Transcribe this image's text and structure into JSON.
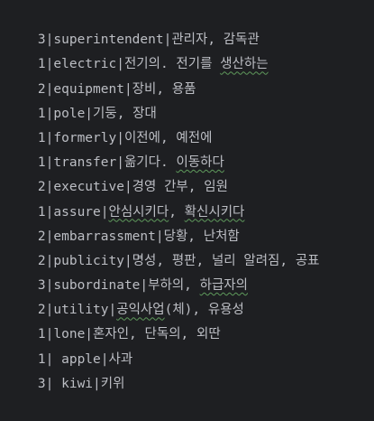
{
  "theme": {
    "background": "#1e1f22",
    "text_color": "#bcbec4",
    "squiggle_color": "#5f9a5c"
  },
  "lines": [
    {
      "segments": [
        {
          "text": "3|superintendent|관리자, 감독관",
          "squiggle": false
        }
      ]
    },
    {
      "segments": [
        {
          "text": "1|electric|전기의. 전기를 ",
          "squiggle": false
        },
        {
          "text": "생산하는",
          "squiggle": true
        }
      ]
    },
    {
      "segments": [
        {
          "text": "2|equipment|장비, 용품",
          "squiggle": false
        }
      ]
    },
    {
      "segments": [
        {
          "text": "1|pole|기둥, 장대",
          "squiggle": false
        }
      ]
    },
    {
      "segments": [
        {
          "text": "1|formerly|이전에, 예전에",
          "squiggle": false
        }
      ]
    },
    {
      "segments": [
        {
          "text": "1|transfer|옮기다. ",
          "squiggle": false
        },
        {
          "text": "이동하다",
          "squiggle": true
        }
      ]
    },
    {
      "segments": [
        {
          "text": "2|executive|경영 간부, 임원",
          "squiggle": false
        }
      ]
    },
    {
      "segments": [
        {
          "text": "1|assure|",
          "squiggle": false
        },
        {
          "text": "안심시키다",
          "squiggle": true
        },
        {
          "text": ", ",
          "squiggle": false
        },
        {
          "text": "확신시키다",
          "squiggle": true
        }
      ]
    },
    {
      "segments": [
        {
          "text": "2|embarrassment|당황, 난처함",
          "squiggle": false
        }
      ]
    },
    {
      "segments": [
        {
          "text": "2|publicity|명성, 평판, 널리 알려짐, 공표",
          "squiggle": false
        }
      ]
    },
    {
      "segments": [
        {
          "text": "3|subordinate|부하의, ",
          "squiggle": false
        },
        {
          "text": "하급자의",
          "squiggle": true
        }
      ]
    },
    {
      "segments": [
        {
          "text": "2|utility|",
          "squiggle": false
        },
        {
          "text": "공익사업",
          "squiggle": true
        },
        {
          "text": "(체), 유용성",
          "squiggle": false
        }
      ]
    },
    {
      "segments": [
        {
          "text": "1|lone|혼자인, 단독의, 외딴",
          "squiggle": false
        }
      ]
    },
    {
      "segments": [
        {
          "text": "1| apple|사과",
          "squiggle": false
        }
      ]
    },
    {
      "segments": [
        {
          "text": "3| kiwi|키위",
          "squiggle": false
        }
      ]
    }
  ]
}
